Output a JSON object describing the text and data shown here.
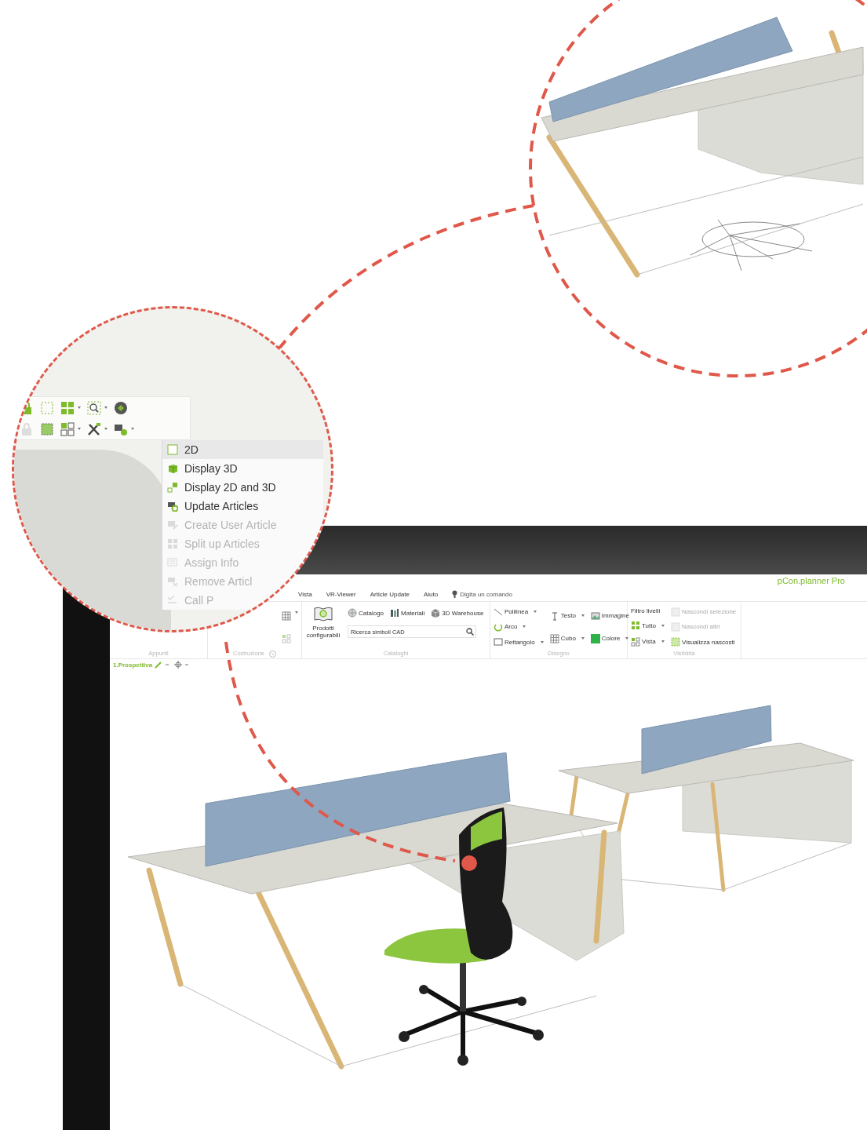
{
  "callout_menu": {
    "header": "2D",
    "items": [
      {
        "label": "Display 3D",
        "disabled": false
      },
      {
        "label": "Display 2D and 3D",
        "disabled": false
      },
      {
        "label": "Update Articles",
        "disabled": false
      },
      {
        "label": "Create User Article",
        "disabled": true
      },
      {
        "label": "Split up Articles",
        "disabled": true
      },
      {
        "label": "Assign Info",
        "disabled": true
      },
      {
        "label": "Remove Articl",
        "disabled": true
      },
      {
        "label": "Call P",
        "disabled": true
      }
    ]
  },
  "app": {
    "title": "pCon.planner Pro"
  },
  "tabs": [
    {
      "label": "Vista"
    },
    {
      "label": "VR-Viewer"
    },
    {
      "label": "Article Update"
    },
    {
      "label": "Aiuto"
    }
  ],
  "command_search": {
    "placeholder": "Digita un comando"
  },
  "ribbon": [
    {
      "label": "Appunti"
    },
    {
      "label": "Costruzione"
    },
    {
      "label": "Cataloghi",
      "large_button": "Prodotti configurabili",
      "buttons": [
        {
          "label": "Catalogo"
        },
        {
          "label": "Materiali"
        },
        {
          "label": "3D Warehouse"
        }
      ],
      "search": {
        "placeholder": "Ricerca simboli CAD"
      }
    },
    {
      "label": "Disegno",
      "columns": [
        [
          {
            "label": "Polilinea",
            "dropdown": true
          },
          {
            "label": "Arco",
            "dropdown": true
          },
          {
            "label": "Rettangolo",
            "dropdown": true
          }
        ],
        [
          {
            "label": "Testo",
            "dropdown": true
          },
          {
            "label": "Cubo",
            "dropdown": true
          }
        ],
        [
          {
            "label": "Immagine",
            "dropdown": false
          },
          {
            "label": "Colore",
            "dropdown": true
          }
        ]
      ]
    },
    {
      "label": "Visibilità",
      "heading": "Filtro livelli",
      "columns": [
        [
          {
            "label": "Tutto",
            "dropdown": true,
            "disabled": false
          },
          {
            "label": "Vista",
            "dropdown": true,
            "disabled": false
          }
        ],
        [
          {
            "label": "Nascondi selezione",
            "dropdown": false,
            "disabled": true
          },
          {
            "label": "Nascondi altri",
            "dropdown": false,
            "disabled": true
          },
          {
            "label": "Visualizza nascosti",
            "dropdown": false,
            "disabled": false
          }
        ]
      ]
    }
  ],
  "view": {
    "label": "1.Prospettiva"
  }
}
